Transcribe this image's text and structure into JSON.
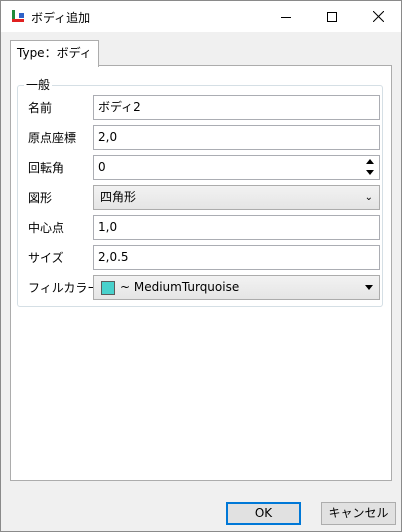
{
  "window": {
    "title": "ボディ追加",
    "buttons": {
      "minimize": "minimize",
      "maximize": "maximize",
      "close": "close"
    }
  },
  "tab": {
    "label": "Type：ボディ"
  },
  "group": {
    "title": "一般"
  },
  "fields": {
    "name": {
      "label": "名前",
      "value": "ボディ2"
    },
    "origin": {
      "label": "原点座標",
      "value": "2,0"
    },
    "rotation": {
      "label": "回転角",
      "value": "0"
    },
    "shape": {
      "label": "図形",
      "value": "四角形"
    },
    "center": {
      "label": "中心点",
      "value": "1,0"
    },
    "size": {
      "label": "サイズ",
      "value": "2,0.5"
    },
    "fill_color": {
      "label": "フィルカラー",
      "value": "~ MediumTurquoise",
      "swatch": "#48d1cc"
    }
  },
  "footer": {
    "ok": "OK",
    "cancel": "キャンセル"
  },
  "colors": {
    "accent": "#0078d7",
    "swatch": "#48d1cc"
  }
}
